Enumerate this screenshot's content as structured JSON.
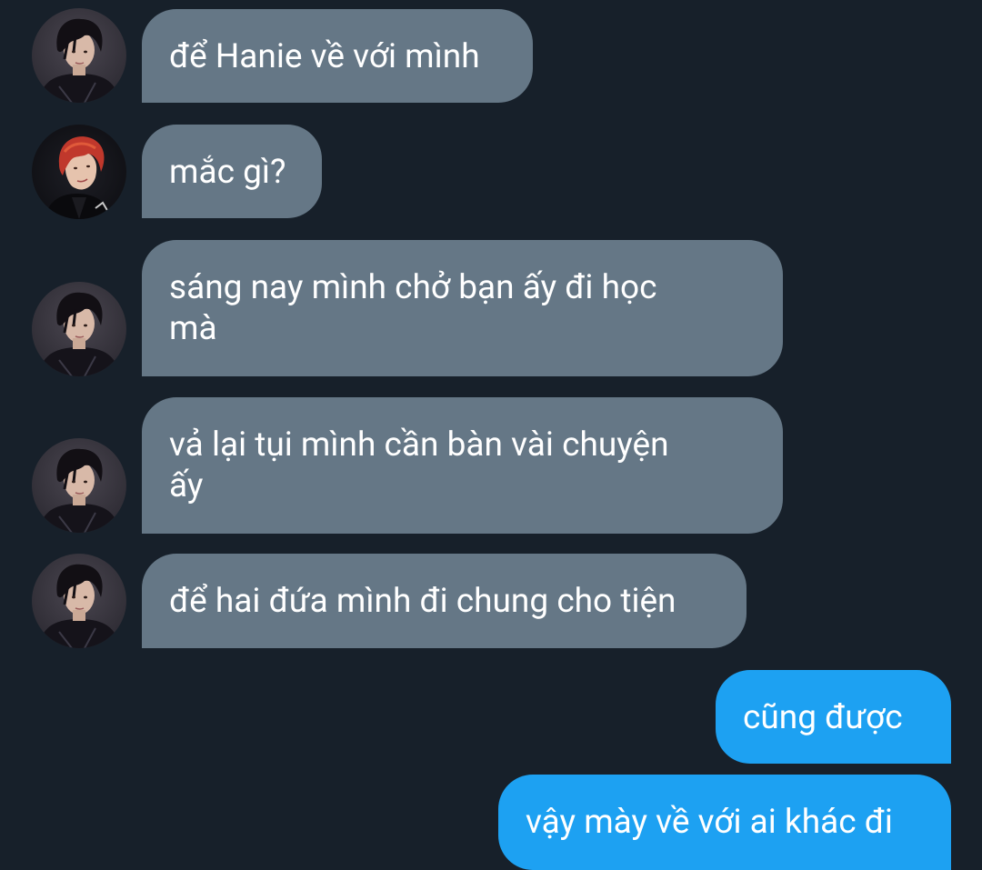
{
  "messages": [
    {
      "text": "để Hanie về với mình",
      "side": "incoming",
      "avatar": "avatar-dark-hair"
    },
    {
      "text": "mắc gì?",
      "side": "incoming",
      "avatar": "avatar-red-hair"
    },
    {
      "line1": "sáng nay mình chở bạn ấy đi học",
      "line2": "mà",
      "side": "incoming",
      "avatar": "avatar-dark-hair"
    },
    {
      "line1": "vả lại tụi mình cần bàn vài chuyện",
      "line2": "ấy",
      "side": "incoming",
      "avatar": "avatar-dark-hair"
    },
    {
      "text": "để hai đứa mình đi chung cho tiện",
      "side": "incoming",
      "avatar": "avatar-dark-hair"
    },
    {
      "text": "cũng được",
      "side": "outgoing"
    },
    {
      "text": "vậy mày về với ai khác đi",
      "side": "outgoing"
    }
  ],
  "colors": {
    "background": "#17202a",
    "incoming_bubble": "#657786",
    "outgoing_bubble": "#1da1f2",
    "text": "#ffffff"
  }
}
